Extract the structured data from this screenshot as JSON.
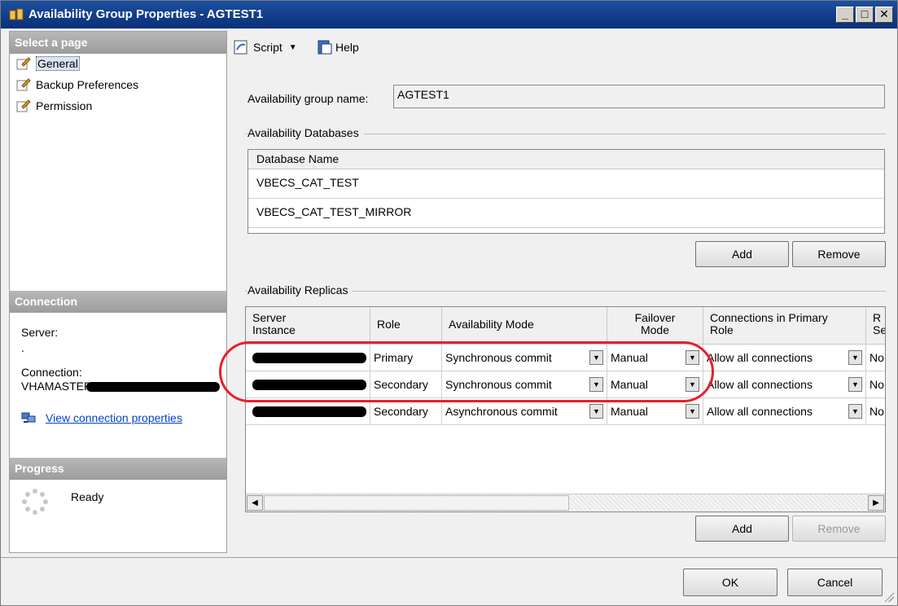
{
  "window": {
    "title": "Availability Group Properties - AGTEST1",
    "minimize_glyph": "_",
    "maximize_glyph": "□",
    "close_glyph": "✕"
  },
  "left": {
    "select_page_title": "Select a page",
    "pages": [
      {
        "label": "General",
        "icon": "page-icon",
        "selected": true
      },
      {
        "label": "Backup Preferences",
        "icon": "page-icon"
      },
      {
        "label": "Permission",
        "icon": "page-icon"
      }
    ],
    "connection_title": "Connection",
    "server_label": "Server:",
    "server_value": ".",
    "connection_label": "Connection:",
    "connection_value": "VHAMASTER",
    "view_connection_properties": "View connection properties",
    "progress_title": "Progress",
    "progress_status": "Ready"
  },
  "toolbar": {
    "script_label": "Script",
    "help_label": "Help"
  },
  "general": {
    "ag_name_label": "Availability group name:",
    "ag_name_value": "AGTEST1",
    "databases_group_title": "Availability Databases",
    "databases_header": "Database Name",
    "databases": [
      "VBECS_CAT_TEST",
      "VBECS_CAT_TEST_MIRROR"
    ],
    "db_add_label": "Add",
    "db_remove_label": "Remove",
    "replicas_group_title": "Availability Replicas",
    "replica_columns": {
      "server_instance": "Server\nInstance",
      "role": "Role",
      "availability_mode": "Availability Mode",
      "failover_mode": "Failover\nMode",
      "connections_primary": "Connections in Primary\nRole",
      "readable_secondary": "R\nSe"
    },
    "replicas": [
      {
        "role": "Primary",
        "availability_mode": "Synchronous commit",
        "failover_mode": "Manual",
        "connections_primary": "Allow all connections",
        "readable_secondary": "No"
      },
      {
        "role": "Secondary",
        "availability_mode": "Synchronous commit",
        "failover_mode": "Manual",
        "connections_primary": "Allow all connections",
        "readable_secondary": "No"
      },
      {
        "role": "Secondary",
        "availability_mode": "Asynchronous commit",
        "failover_mode": "Manual",
        "connections_primary": "Allow all connections",
        "readable_secondary": "No"
      }
    ],
    "replica_add_label": "Add",
    "replica_remove_label": "Remove"
  },
  "footer": {
    "ok_label": "OK",
    "cancel_label": "Cancel"
  },
  "colors": {
    "titlebar": "#0a2f78",
    "highlight": "#e8202a",
    "link": "#0044cc"
  }
}
